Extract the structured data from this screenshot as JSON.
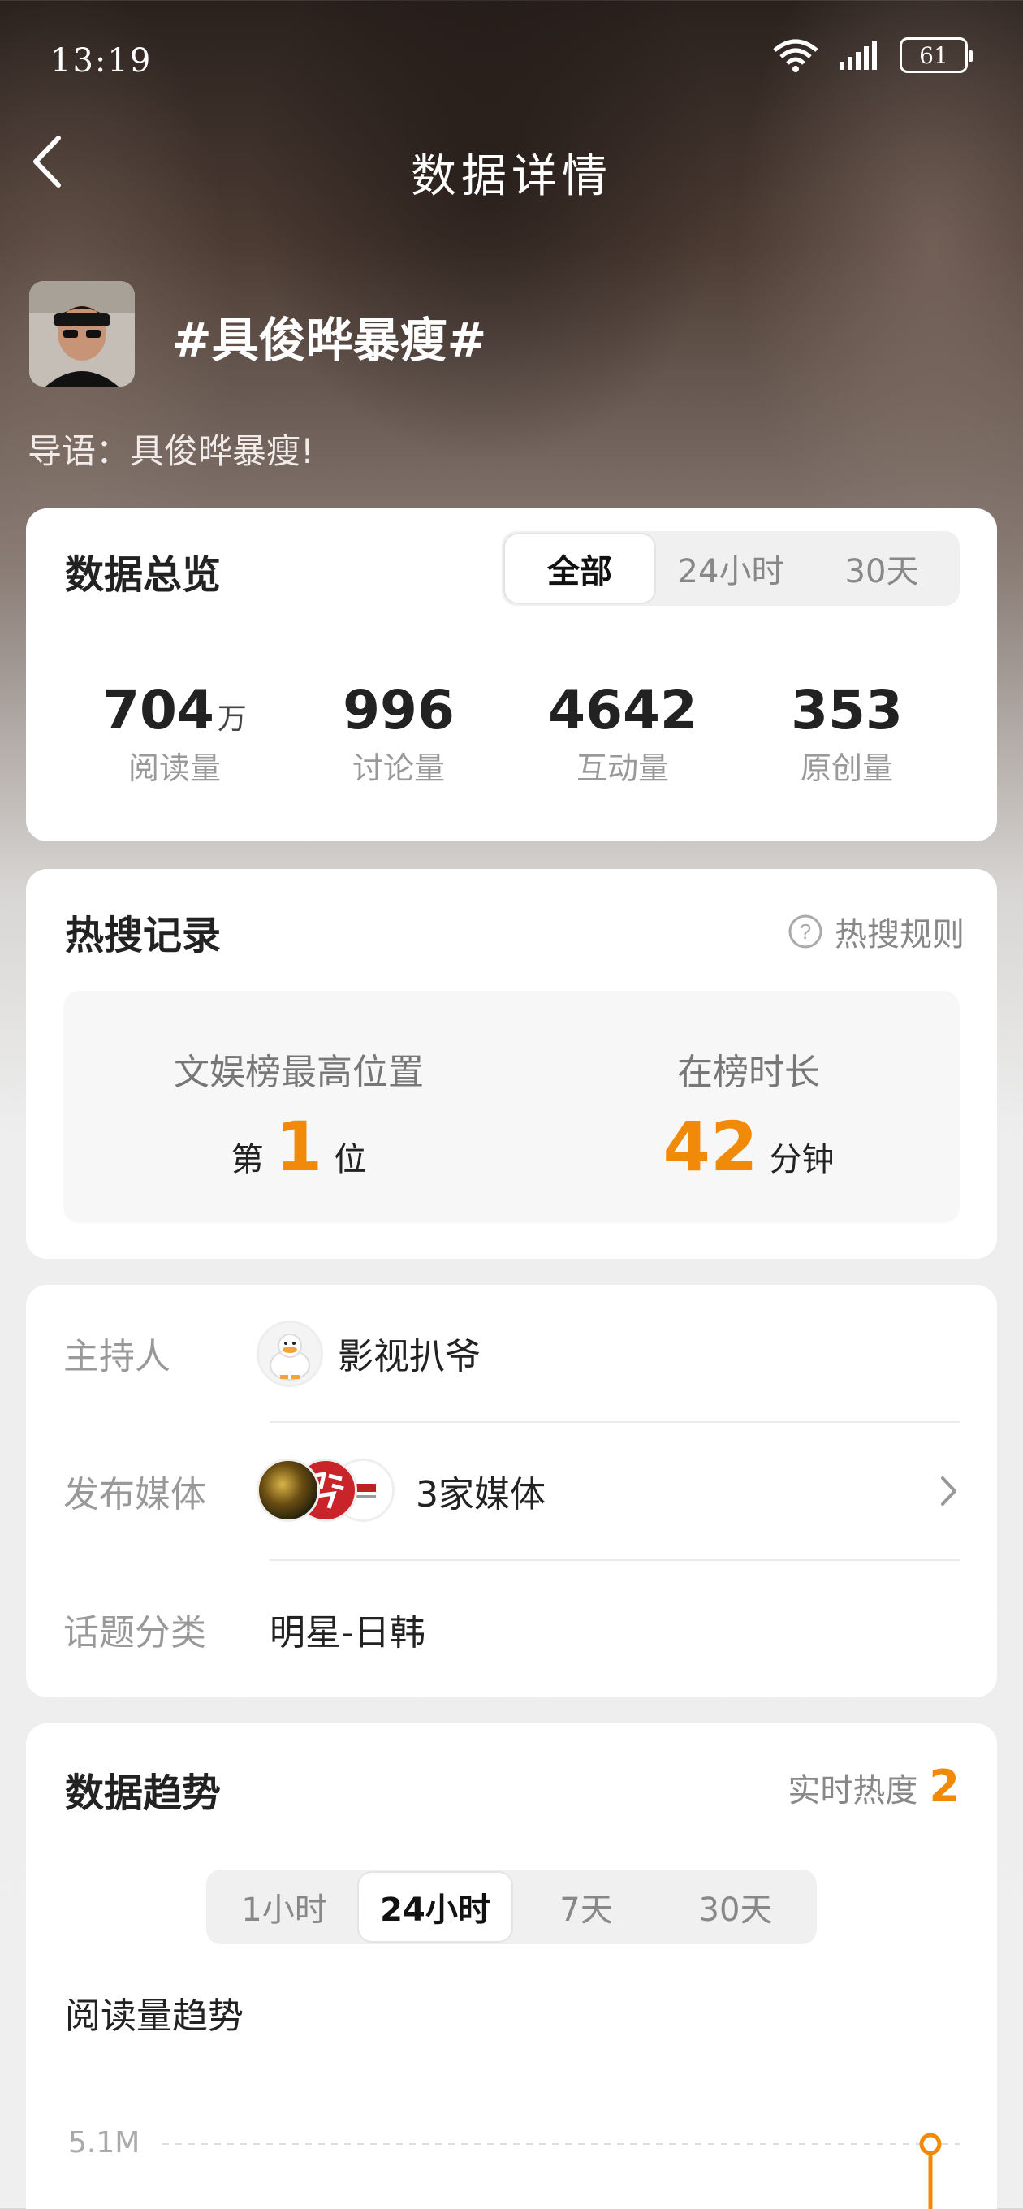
{
  "status": {
    "time": "13:19",
    "battery": "61"
  },
  "nav": {
    "title": "数据详情"
  },
  "topic": {
    "title": "#具俊晔暴瘦#",
    "intro": "导语：具俊晔暴瘦!"
  },
  "overview": {
    "title": "数据总览",
    "tabs": [
      "全部",
      "24小时",
      "30天"
    ],
    "stats": [
      {
        "value": "704",
        "unit": "万",
        "label": "阅读量"
      },
      {
        "value": "996",
        "label": "讨论量"
      },
      {
        "value": "4642",
        "label": "互动量"
      },
      {
        "value": "353",
        "label": "原创量"
      }
    ]
  },
  "hot": {
    "title": "热搜记录",
    "rules": "热搜规则",
    "best_label": "文娱榜最高位置",
    "best_prefix": "第",
    "best_value": "1",
    "best_suffix": "位",
    "duration_label": "在榜时长",
    "duration_value": "42",
    "duration_unit": "分钟"
  },
  "info": {
    "host_key": "主持人",
    "host_name": "影视扒爷",
    "media_key": "发布媒体",
    "media_value": "3家媒体",
    "category_key": "话题分类",
    "category_value": "明星-日韩"
  },
  "trend": {
    "title": "数据趋势",
    "realtime_label": "实时热度",
    "realtime_value": "2",
    "tabs": [
      "1小时",
      "24小时",
      "7天",
      "30天"
    ],
    "chart_label": "阅读量趋势",
    "y_tick": "5.1M"
  },
  "colors": {
    "accent": "#f08a08",
    "card": "#ffffff"
  }
}
